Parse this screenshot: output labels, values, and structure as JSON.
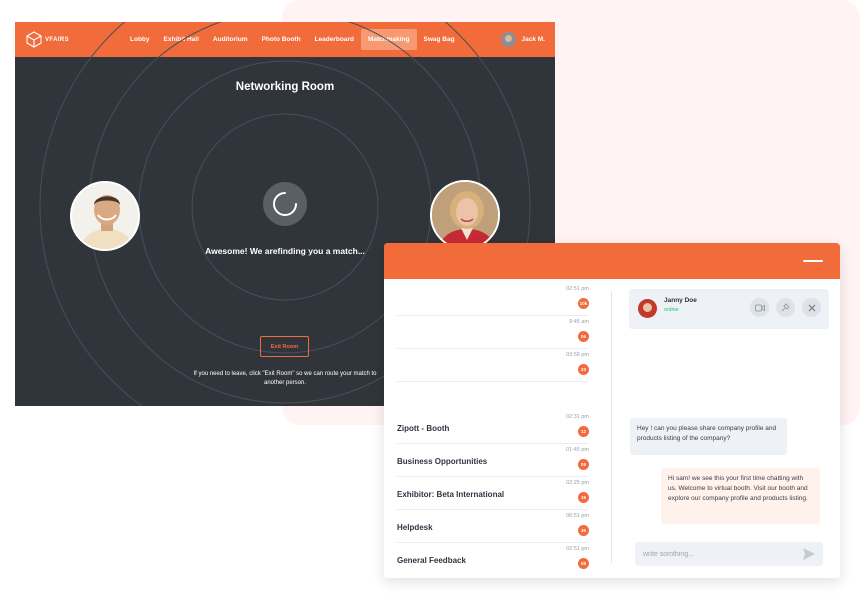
{
  "brand": {
    "name": "VFAIRS"
  },
  "nav": {
    "items": [
      {
        "label": "Lobby"
      },
      {
        "label": "Exhibit Hall"
      },
      {
        "label": "Auditorium"
      },
      {
        "label": "Photo Booth"
      },
      {
        "label": "Leaderboard"
      },
      {
        "label": "Matchmaking",
        "active": true
      },
      {
        "label": "Swag Bag"
      }
    ]
  },
  "user": {
    "name": "Jack M."
  },
  "room": {
    "title": "Networking Room",
    "status": "Awesome! We arefinding you a match...",
    "exit_label": "Exit Room",
    "exit_note": "If you need to leave, click \"Exit Room\" so we can route your match to another person."
  },
  "chat": {
    "conversations": [
      {
        "name": "",
        "time": "02:51 pm",
        "badge": "10k"
      },
      {
        "name": "",
        "time": "9:45 am",
        "badge": "06"
      },
      {
        "name": "",
        "time": "03:58 pm",
        "badge": "23"
      },
      {
        "name": "Zipott - Booth",
        "time": "02:31 pm",
        "badge": "12"
      },
      {
        "name": "Business Opportunities",
        "time": "01:45 pm",
        "badge": "09"
      },
      {
        "name": "Exhibitor: Beta International",
        "time": "02:25 pm",
        "badge": "15"
      },
      {
        "name": "Helpdesk",
        "time": "06:51 pm",
        "badge": "36"
      },
      {
        "name": "General Feedback",
        "time": "02:51 pm",
        "badge": "08"
      }
    ],
    "contact": {
      "name": "Janny Doe",
      "status": "online"
    },
    "messages": [
      {
        "direction": "incoming",
        "text": "Hey ! can you please share company profile and products listing of the company?"
      },
      {
        "direction": "outgoing",
        "text": "Hi sam! we see this your first time chatting with us. Welcome to virtual booth. Visit our booth and explore our company profile and products listing."
      }
    ],
    "composer_placeholder": "write somthing..."
  },
  "colors": {
    "accent": "#f26b3a",
    "dark_bg": "#30343b",
    "online": "#27c26c"
  },
  "icons": [
    "vfairs-logo-icon",
    "spinner-icon",
    "video-call-icon",
    "pin-icon",
    "close-icon",
    "send-icon",
    "minimize-icon"
  ]
}
